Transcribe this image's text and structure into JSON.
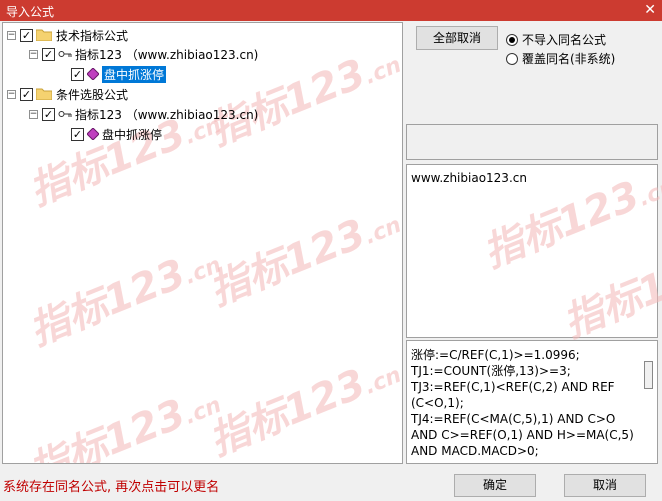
{
  "window": {
    "title": "导入公式",
    "close_glyph": "✕"
  },
  "tree": {
    "nodes": [
      {
        "label": "技术指标公式",
        "checked": true,
        "expander": "−"
      },
      {
        "label": "指标123 （www.zhibiao123.cn)",
        "checked": true,
        "expander": "−"
      },
      {
        "label": "盘中抓涨停",
        "checked": true,
        "selected": true
      },
      {
        "label": "条件选股公式",
        "checked": true,
        "expander": "−"
      },
      {
        "label": "指标123 （www.zhibiao123.cn)",
        "checked": true,
        "expander": "−"
      },
      {
        "label": "盘中抓涨停",
        "checked": true
      }
    ],
    "check_glyph": "✓"
  },
  "watermark": {
    "text": "指标123",
    "suffix": ".cn"
  },
  "buttons": {
    "cancel_all": "全部取消",
    "ok": "确定",
    "cancel": "取消"
  },
  "options": {
    "no_import": "不导入同名公式",
    "overwrite": "覆盖同名(非系统)",
    "selected": "no_import"
  },
  "info": {
    "url": "www.zhibiao123.cn"
  },
  "formula": {
    "lines": [
      "涨停:=C/REF(C,1)>=1.0996;",
      "TJ1:=COUNT(涨停,13)>=3;",
      "TJ3:=REF(C,1)<REF(C,2) AND REF",
      "(C<O,1);",
      "TJ4:=REF(C<MA(C,5),1) AND C>O",
      "AND C>=REF(O,1) AND H>=MA(C,5)",
      "AND MACD.MACD>0;"
    ]
  },
  "status": {
    "message": "系统存在同名公式, 再次点击可以更名"
  },
  "colors": {
    "titlebar": "#cc3b30",
    "selection": "#0078d7",
    "status_text": "#c00000"
  }
}
